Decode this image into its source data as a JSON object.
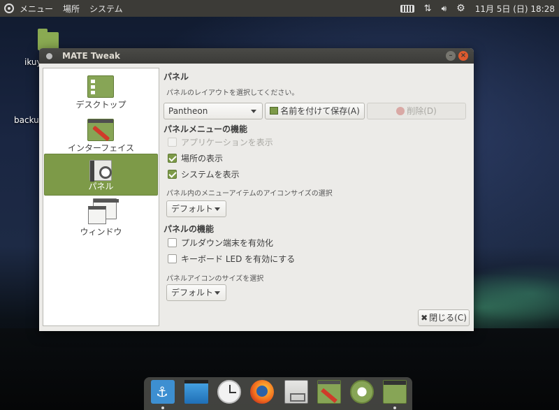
{
  "top_panel": {
    "menu_items": [
      "メニュー",
      "場所",
      "システム"
    ],
    "clock": "11月 5日 (日) 18:28"
  },
  "desktop": {
    "icon_labels": [
      "ikuy",
      "backup"
    ]
  },
  "window": {
    "title": "MATE Tweak",
    "sidebar": [
      {
        "label": "デスクトップ",
        "icon": "desktop-icon"
      },
      {
        "label": "インターフェイス",
        "icon": "interface-icon"
      },
      {
        "label": "パネル",
        "icon": "panel-icon",
        "active": true
      },
      {
        "label": "ウィンドウ",
        "icon": "window-icon"
      }
    ],
    "panel": {
      "title": "パネル",
      "layout_hint": "パネルのレイアウトを選択してください。",
      "layout_value": "Pantheon",
      "save_label": "名前を付けて保存(A)",
      "delete_label": "削除(D)",
      "menu_section_title": "パネルメニューの機能",
      "show_apps": "アプリケーションを表示",
      "show_places": "場所の表示",
      "show_system": "システムを表示",
      "menu_icon_size_label": "パネル内のメニューアイテムのアイコンサイズの選択",
      "menu_icon_size_value": "デフォルト",
      "features_title": "パネルの機能",
      "pulldown_terminal": "プルダウン端末を有効化",
      "keyboard_led": "キーボード LED を有効にする",
      "panel_icon_size_label": "パネルアイコンのサイズを選択",
      "panel_icon_size_value": "デフォルト",
      "close_label": "閉じる(C)"
    }
  },
  "accent_color": "#7d9a48"
}
